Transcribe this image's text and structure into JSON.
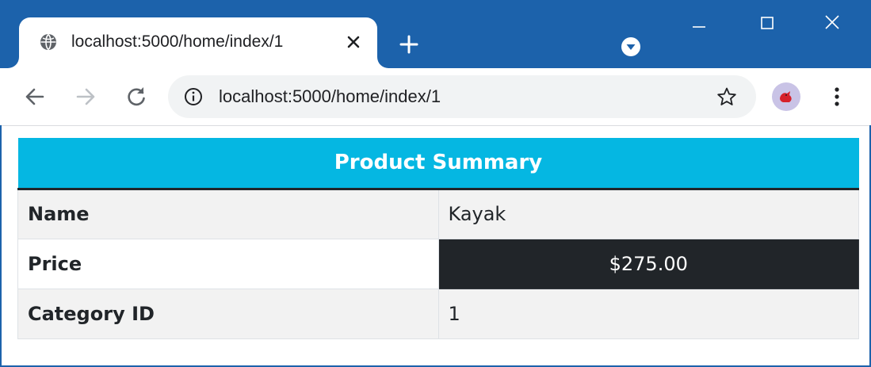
{
  "browser": {
    "tab_title": "localhost:5000/home/index/1",
    "url": "localhost:5000/home/index/1",
    "new_tab_symbol": "+",
    "icons": {
      "favicon": "globe-icon",
      "tab_close": "close-icon",
      "new_tab": "plus-icon",
      "profile": "profile-dropdown-icon",
      "minimize": "minimize-icon",
      "maximize": "maximize-icon",
      "close": "window-close-icon",
      "back": "arrow-left-icon",
      "forward": "arrow-right-icon",
      "reload": "reload-icon",
      "info": "info-icon",
      "bookmark": "star-icon",
      "menu": "kebab-menu-icon"
    },
    "colors": {
      "frame": "#1c62ab",
      "omnibox": "#f1f3f4"
    }
  },
  "page": {
    "table": {
      "header": "Product Summary",
      "rows": [
        {
          "label": "Name",
          "value": "Kayak"
        },
        {
          "label": "Price",
          "value": "$275.00"
        },
        {
          "label": "Category ID",
          "value": "1"
        }
      ],
      "colors": {
        "header_bg": "#05b7e2",
        "highlight_bg": "#212529",
        "stripe_bg": "#f2f2f2"
      }
    }
  }
}
